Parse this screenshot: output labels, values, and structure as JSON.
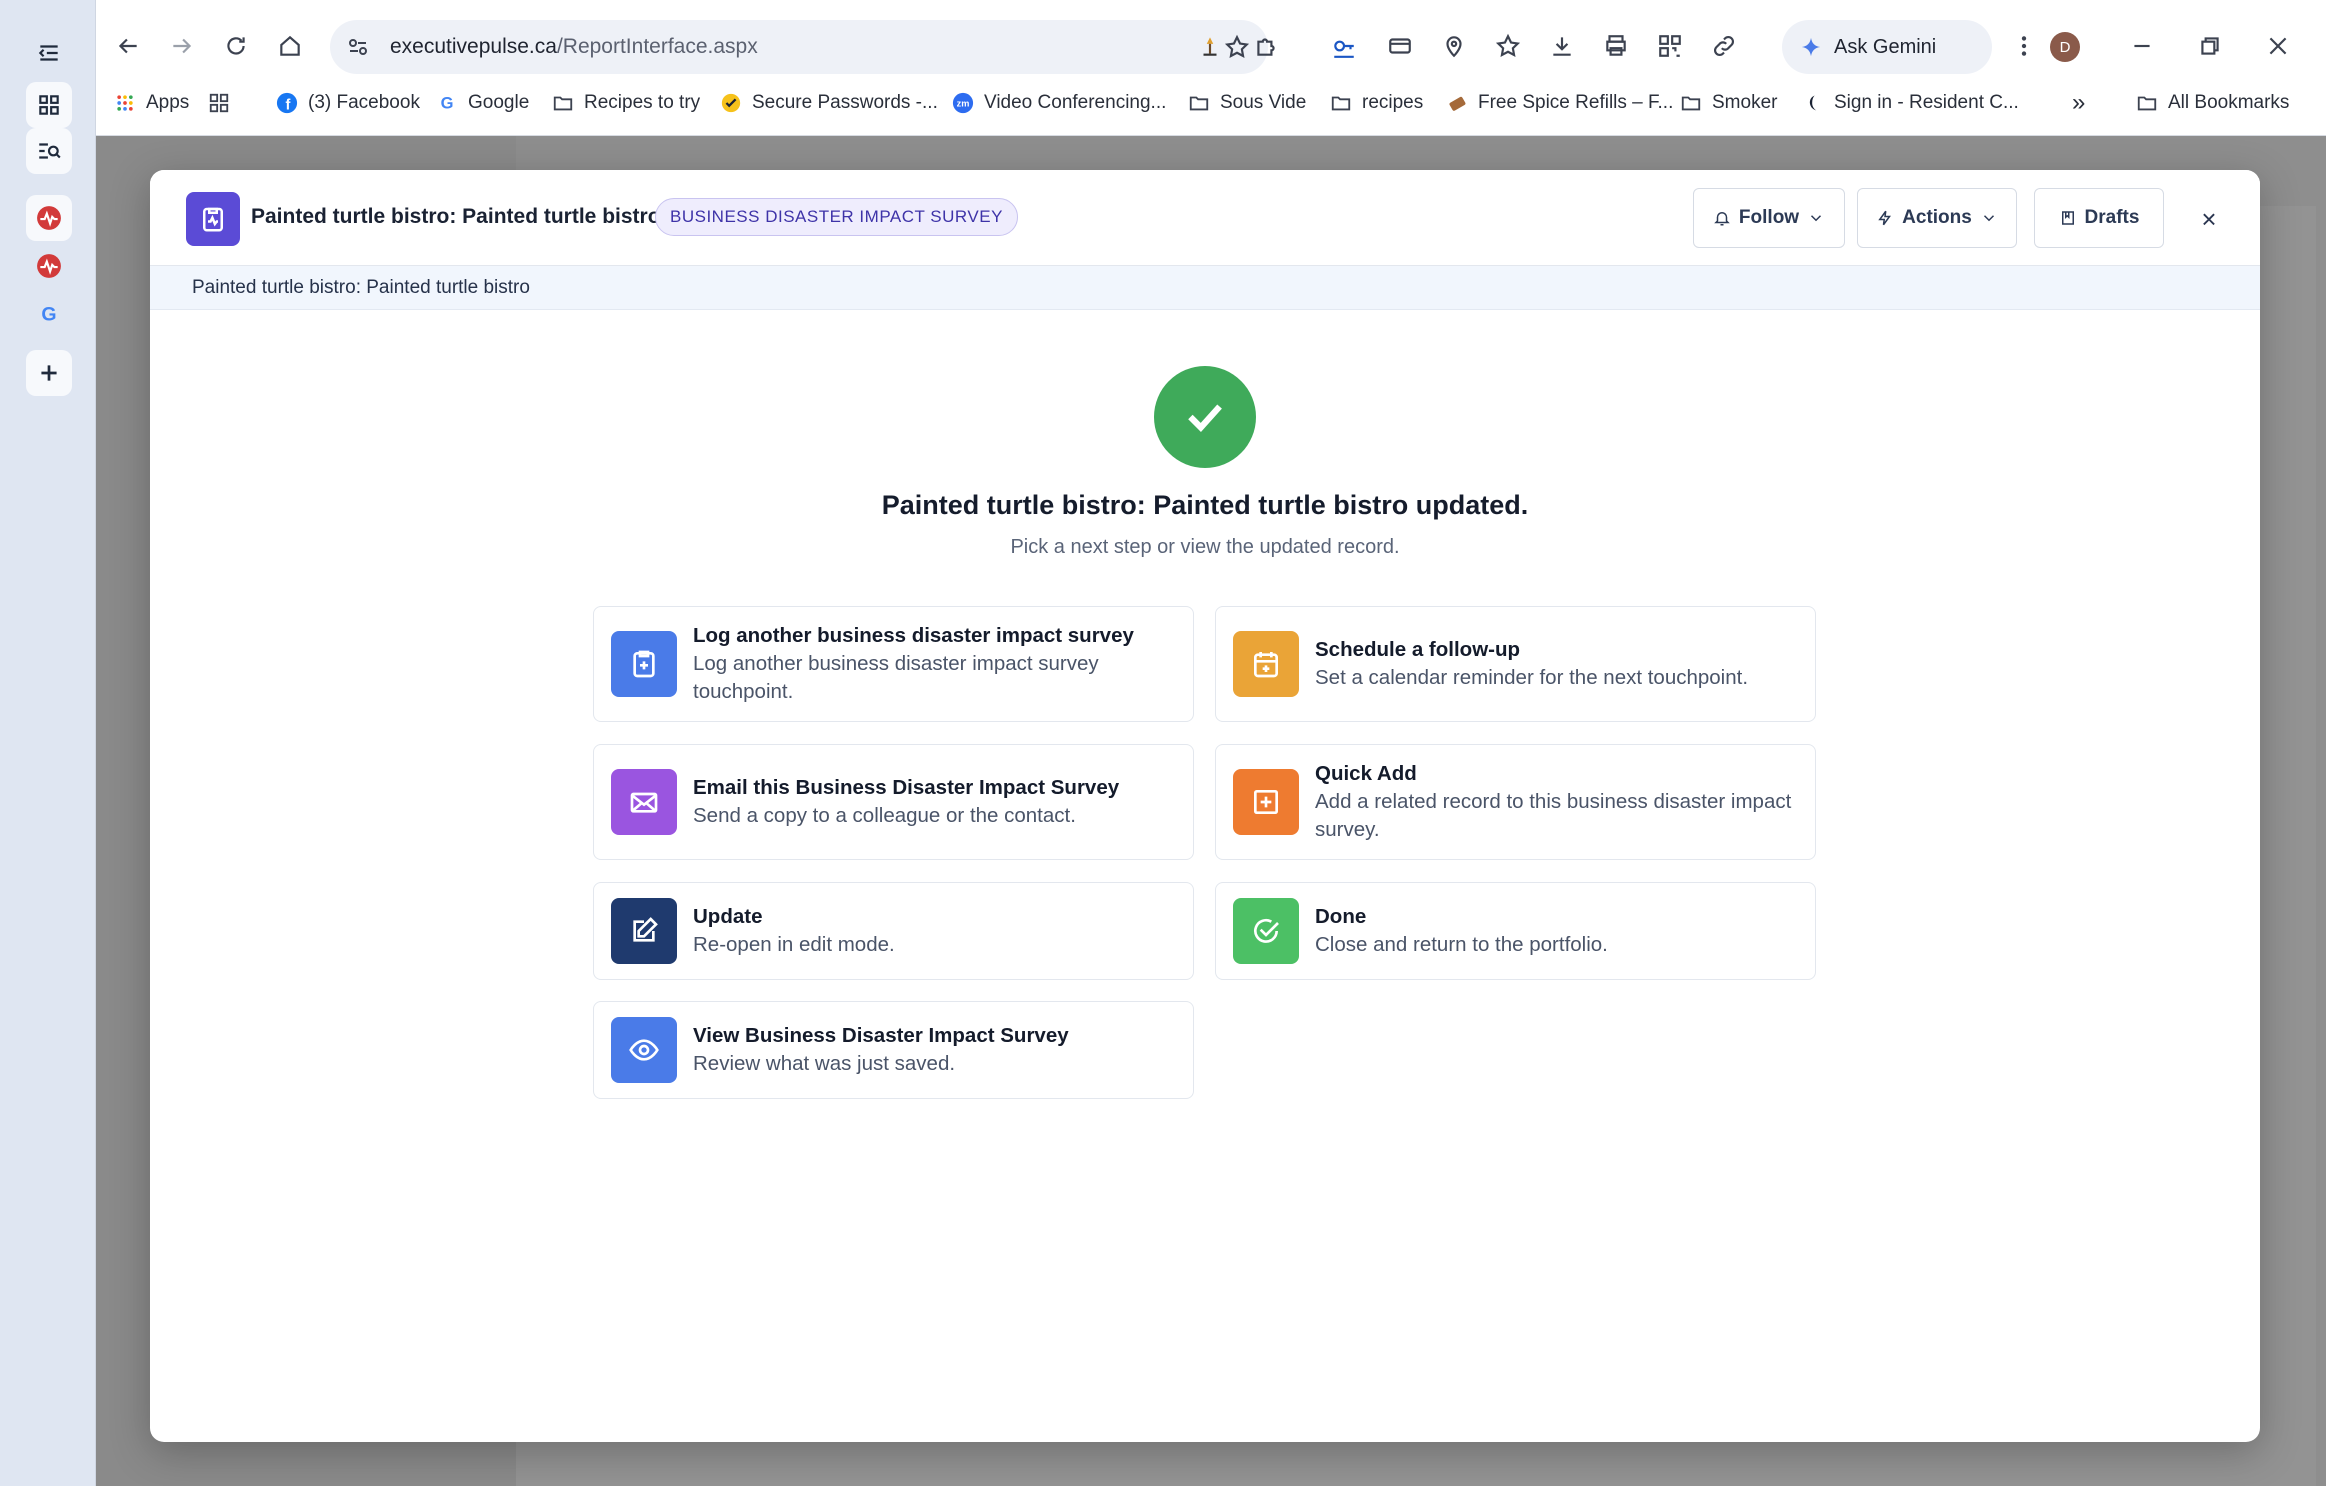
{
  "browser": {
    "url_domain": "executivepulse.ca",
    "url_path": "/ReportInterface.aspx",
    "gemini_label": "Ask Gemini",
    "profile_initial": "D",
    "bookmarks": [
      {
        "label": "Apps",
        "icon": "apps-grid-icon"
      },
      {
        "label": "",
        "icon": "grid-icon"
      },
      {
        "label": "(3) Facebook",
        "icon": "facebook-icon"
      },
      {
        "label": "Google",
        "icon": "google-icon"
      },
      {
        "label": "Recipes to try",
        "icon": "folder-icon"
      },
      {
        "label": "Secure Passwords -...",
        "icon": "checkmark-icon"
      },
      {
        "label": "Video Conferencing...",
        "icon": "zoom-icon"
      },
      {
        "label": "Sous Vide",
        "icon": "folder-icon"
      },
      {
        "label": "recipes",
        "icon": "folder-icon"
      },
      {
        "label": "Free Spice Refills – F...",
        "icon": "spice-icon"
      },
      {
        "label": "Smoker",
        "icon": "folder-icon"
      },
      {
        "label": "Sign in - Resident C...",
        "icon": "resident-icon"
      }
    ],
    "all_bookmarks": "All Bookmarks",
    "overflow_label": "»"
  },
  "modal": {
    "title": "Painted turtle bistro: Painted turtle bistro",
    "badge": "BUSINESS DISASTER IMPACT SURVEY",
    "follow_label": "Follow",
    "actions_label": "Actions",
    "drafts_label": "Drafts",
    "close_label": "×",
    "breadcrumb": "Painted turtle bistro: Painted turtle bistro",
    "success_title": "Painted turtle bistro: Painted turtle bistro updated.",
    "success_subtitle": "Pick a next step or view the updated record.",
    "cards": [
      {
        "title": "Log another business disaster impact survey",
        "desc": "Log another business disaster impact survey touchpoint.",
        "icon": "clipboard-plus-icon",
        "color": "#4a7be8"
      },
      {
        "title": "Schedule a follow-up",
        "desc": "Set a calendar reminder for the next touchpoint.",
        "icon": "calendar-plus-icon",
        "color": "#eaa437"
      },
      {
        "title": "Email this Business Disaster Impact Survey",
        "desc": "Send a copy to a colleague or the contact.",
        "icon": "envelope-icon",
        "color": "#9a55e0"
      },
      {
        "title": "Quick Add",
        "desc": "Add a related record to this business disaster impact survey.",
        "icon": "plus-square-icon",
        "color": "#ee7b30"
      },
      {
        "title": "Update",
        "desc": "Re-open in edit mode.",
        "icon": "edit-icon",
        "color": "#1f3a6e"
      },
      {
        "title": "Done",
        "desc": "Close and return to the portfolio.",
        "icon": "check-circle-icon",
        "color": "#4cc065"
      },
      {
        "title": "View Business Disaster Impact Survey",
        "desc": "Review what was just saved.",
        "icon": "eye-icon",
        "color": "#4a7be8"
      }
    ]
  }
}
